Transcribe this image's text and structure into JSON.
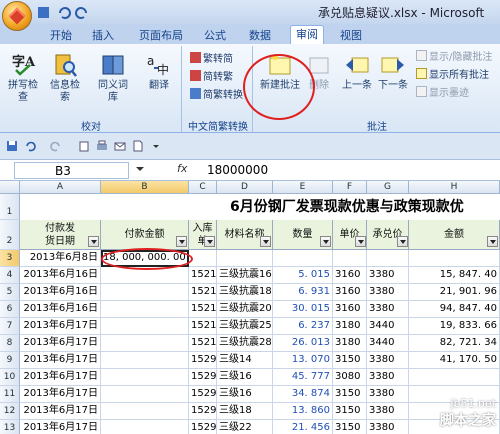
{
  "window": {
    "title": "承兑贴息疑议.xlsx - Microsoft"
  },
  "tabs": [
    "开始",
    "插入",
    "页面布局",
    "公式",
    "数据",
    "审阅",
    "视图"
  ],
  "active_tab": "审阅",
  "ribbon": {
    "proofing": {
      "label": "校对",
      "buttons": [
        "拼写检查",
        "信息检索",
        "同义词库",
        "翻译"
      ]
    },
    "chinese_conversion": {
      "label": "中文简繁转换",
      "buttons": [
        "繁转简",
        "简转繁",
        "简繁转换"
      ]
    },
    "comments": {
      "label": "批注",
      "new_comment": "新建批注",
      "delete": "删除",
      "previous": "上一条",
      "next": "下一条",
      "show_hide": "显示/隐藏批注",
      "show_all": "显示所有批注",
      "show_ink": "显示墨迹"
    }
  },
  "formula_bar": {
    "name_box": "B3",
    "fx": "fx",
    "value": "18000000"
  },
  "sheet": {
    "title": "6月份钢厂发票现款优惠与政策现款优",
    "columns": [
      "A",
      "B",
      "C",
      "D",
      "E",
      "F",
      "G",
      "H"
    ],
    "headers": [
      "付款发\n货日期",
      "付款金额",
      "入库\n单",
      "材料名称",
      "数量",
      "单价",
      "承兑价",
      "金额"
    ],
    "rows": [
      {
        "n": "1"
      },
      {
        "n": "2"
      },
      {
        "n": "3",
        "a": "2013年6月8日",
        "b": "18, 000, 000. 00",
        "c": "",
        "d": "",
        "e": "",
        "f": "",
        "g": "",
        "h": ""
      },
      {
        "n": "4",
        "a": "2013年6月16日",
        "b": "",
        "c": "1521",
        "d": "三级抗震16",
        "e": "5. 015",
        "f": "3160",
        "g": "3380",
        "h": "15, 847. 40"
      },
      {
        "n": "5",
        "a": "2013年6月16日",
        "b": "",
        "c": "1521",
        "d": "三级抗震18",
        "e": "6. 931",
        "f": "3160",
        "g": "3380",
        "h": "21, 901. 96"
      },
      {
        "n": "6",
        "a": "2013年6月16日",
        "b": "",
        "c": "1521",
        "d": "三级抗震20",
        "e": "30. 015",
        "f": "3160",
        "g": "3380",
        "h": "94, 847. 40"
      },
      {
        "n": "7",
        "a": "2013年6月17日",
        "b": "",
        "c": "1521",
        "d": "三级抗震25",
        "e": "6. 237",
        "f": "3180",
        "g": "3440",
        "h": "19, 833. 66"
      },
      {
        "n": "8",
        "a": "2013年6月17日",
        "b": "",
        "c": "1521",
        "d": "三级抗震28",
        "e": "26. 013",
        "f": "3180",
        "g": "3440",
        "h": "82, 721. 34"
      },
      {
        "n": "9",
        "a": "2013年6月17日",
        "b": "",
        "c": "1529",
        "d": "三级14",
        "e": "13. 070",
        "f": "3150",
        "g": "3380",
        "h": "41, 170. 50"
      },
      {
        "n": "10",
        "a": "2013年6月17日",
        "b": "",
        "c": "1529",
        "d": "三级16",
        "e": "45. 777",
        "f": "3080",
        "g": "3380",
        "h": ""
      },
      {
        "n": "11",
        "a": "2013年6月17日",
        "b": "",
        "c": "1529",
        "d": "三级16",
        "e": "34. 874",
        "f": "3150",
        "g": "3380",
        "h": ""
      },
      {
        "n": "12",
        "a": "2013年6月17日",
        "b": "",
        "c": "1529",
        "d": "三级18",
        "e": "13. 860",
        "f": "3150",
        "g": "3380",
        "h": ""
      },
      {
        "n": "13",
        "a": "2013年6月17日",
        "b": "",
        "c": "1529",
        "d": "三级22",
        "e": "21. 456",
        "f": "3150",
        "g": "3380",
        "h": ""
      }
    ]
  },
  "watermark": {
    "line1": "jb51.net",
    "line2": "脚本之家"
  },
  "colors": {
    "annotation_ring": "#e02020",
    "header_band": "#e9f3dd"
  }
}
